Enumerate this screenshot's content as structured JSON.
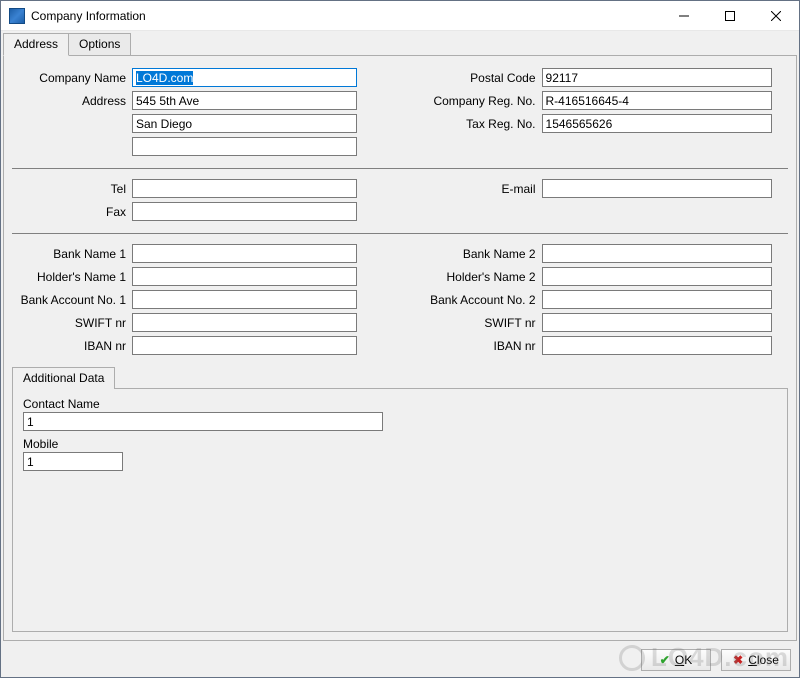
{
  "window": {
    "title": "Company Information"
  },
  "tabs": {
    "address": "Address",
    "options": "Options"
  },
  "fields": {
    "company_name": {
      "label": "Company Name",
      "value": "LO4D.com"
    },
    "address1": {
      "label": "Address",
      "value": "545 5th Ave"
    },
    "address2": {
      "value": "San Diego"
    },
    "address3": {
      "value": ""
    },
    "postal_code": {
      "label": "Postal Code",
      "value": "92117"
    },
    "company_reg": {
      "label": "Company Reg. No.",
      "value": "R-416516645-4"
    },
    "tax_reg": {
      "label": "Tax Reg. No.",
      "value": "1546565626"
    },
    "tel": {
      "label": "Tel",
      "value": ""
    },
    "fax": {
      "label": "Fax",
      "value": ""
    },
    "email": {
      "label": "E-mail",
      "value": ""
    },
    "bank_name_1": {
      "label": "Bank Name  1",
      "value": ""
    },
    "holder_name_1": {
      "label": "Holder's Name  1",
      "value": ""
    },
    "bank_acct_1": {
      "label": "Bank Account No.  1",
      "value": ""
    },
    "swift_1": {
      "label": "SWIFT nr",
      "value": ""
    },
    "iban_1": {
      "label": "IBAN nr",
      "value": ""
    },
    "bank_name_2": {
      "label": "Bank Name  2",
      "value": ""
    },
    "holder_name_2": {
      "label": "Holder's Name  2",
      "value": ""
    },
    "bank_acct_2": {
      "label": "Bank Account No.  2",
      "value": ""
    },
    "swift_2": {
      "label": "SWIFT nr",
      "value": ""
    },
    "iban_2": {
      "label": "IBAN nr",
      "value": ""
    }
  },
  "additional": {
    "tab_label": "Additional Data",
    "contact_name": {
      "label": "Contact Name",
      "value": "1"
    },
    "mobile": {
      "label": "Mobile",
      "value": "1"
    }
  },
  "buttons": {
    "ok": "OK",
    "close": "Close"
  },
  "watermark": "LO4D.com"
}
